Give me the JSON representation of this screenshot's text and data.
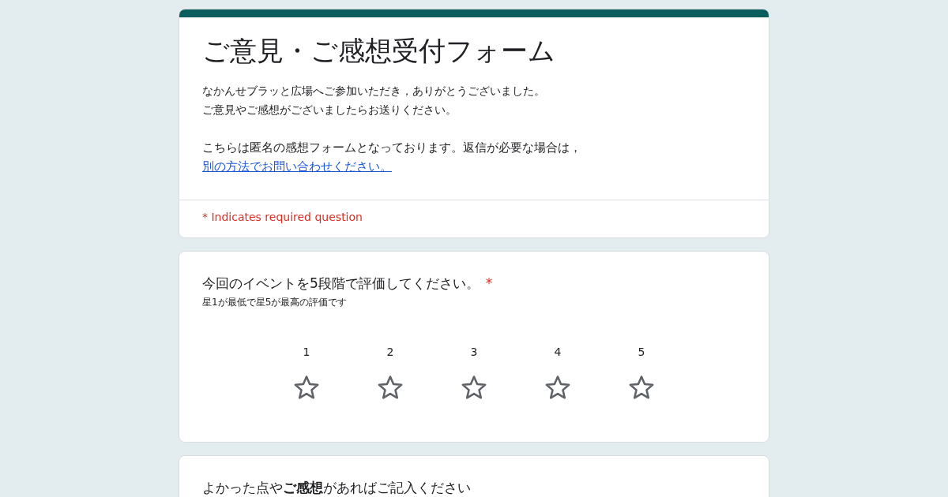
{
  "header": {
    "title": "ご意見・ご感想受付フォーム",
    "description": [
      "なかんせブラッと広場へご参加いただき，ありがとうございました。",
      "ご意見やご感想がございましたらお送りください。"
    ],
    "notice": "こちらは匿名の感想フォームとなっております。返信が必要な場合は，",
    "notice_link": "別の方法でお問い合わせください。",
    "required_note": "* Indicates required question"
  },
  "questions": [
    {
      "kind": "rating",
      "title": "今回のイベントを5段階で評価してください。",
      "required_mark": "*",
      "help": "星1が最低で星5が最高の評価です",
      "labels": [
        "1",
        "2",
        "3",
        "4",
        "5"
      ],
      "stars": 0
    },
    {
      "kind": "text",
      "title": "よかった点や**ご感想**があればご記入ください"
    }
  ]
}
